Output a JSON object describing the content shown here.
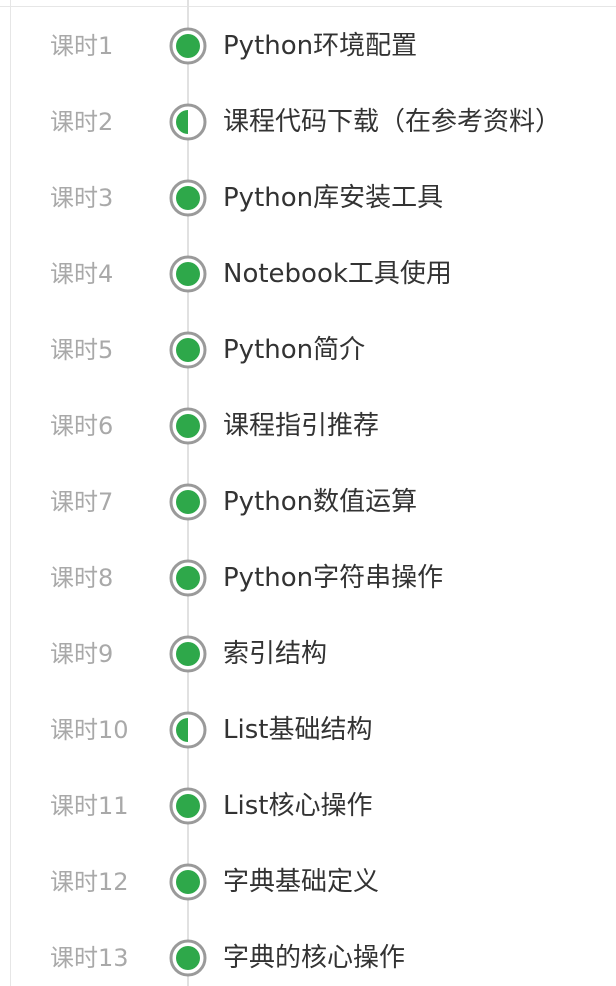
{
  "lessons": [
    {
      "num": "课时1",
      "title": "Python环境配置",
      "status": "complete"
    },
    {
      "num": "课时2",
      "title": "课程代码下载（在参考资料）",
      "status": "partial"
    },
    {
      "num": "课时3",
      "title": "Python库安装工具",
      "status": "complete"
    },
    {
      "num": "课时4",
      "title": "Notebook工具使用",
      "status": "complete"
    },
    {
      "num": "课时5",
      "title": "Python简介",
      "status": "complete"
    },
    {
      "num": "课时6",
      "title": "课程指引推荐",
      "status": "complete"
    },
    {
      "num": "课时7",
      "title": "Python数值运算",
      "status": "complete"
    },
    {
      "num": "课时8",
      "title": "Python字符串操作",
      "status": "complete"
    },
    {
      "num": "课时9",
      "title": "索引结构",
      "status": "complete"
    },
    {
      "num": "课时10",
      "title": "List基础结构",
      "status": "partial"
    },
    {
      "num": "课时11",
      "title": "List核心操作",
      "status": "complete"
    },
    {
      "num": "课时12",
      "title": "字典基础定义",
      "status": "complete"
    },
    {
      "num": "课时13",
      "title": "字典的核心操作",
      "status": "complete"
    }
  ],
  "colors": {
    "progress_green": "#2ea84a",
    "ring_gray": "#9a9a9a",
    "lesson_number": "#a9a9a9",
    "lesson_title": "#333333",
    "timeline": "#e1e1e1"
  },
  "icons": {
    "complete": "progress-complete-icon",
    "partial": "progress-half-icon"
  }
}
